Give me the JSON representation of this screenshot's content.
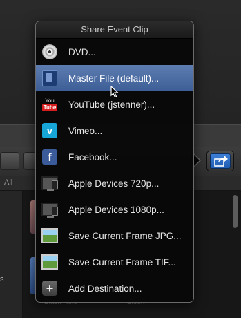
{
  "menu": {
    "title": "Share Event Clip",
    "items": [
      {
        "label": "DVD...",
        "icon": "dvd-icon",
        "selected": false
      },
      {
        "label": "Master File (default)...",
        "icon": "film-icon",
        "selected": true
      },
      {
        "label": "YouTube (jstenner)...",
        "icon": "youtube-icon",
        "selected": false
      },
      {
        "label": "Vimeo...",
        "icon": "vimeo-icon",
        "selected": false
      },
      {
        "label": "Facebook...",
        "icon": "facebook-icon",
        "selected": false
      },
      {
        "label": "Apple Devices 720p...",
        "icon": "apple-devices-icon",
        "selected": false
      },
      {
        "label": "Apple Devices 1080p...",
        "icon": "apple-devices-icon",
        "selected": false
      },
      {
        "label": "Save Current Frame JPG...",
        "icon": "image-icon",
        "selected": false
      },
      {
        "label": "Save Current Frame TIF...",
        "icon": "image-icon",
        "selected": false
      },
      {
        "label": "Add Destination...",
        "icon": "plus-icon",
        "selected": false
      }
    ]
  },
  "youtube_icon": {
    "top": "You",
    "bottom": "Tube"
  },
  "vimeo_icon": {
    "glyph": "v"
  },
  "facebook_icon": {
    "glyph": "f"
  },
  "plus_icon": {
    "glyph": "+"
  },
  "background": {
    "filter_label": "All",
    "sidebar_text": "s",
    "bottom_labels": [
      "Black Hole",
      "Bloom"
    ]
  },
  "colors": {
    "selection": "#4a6aa3",
    "share_button": "#2f6fc4"
  }
}
